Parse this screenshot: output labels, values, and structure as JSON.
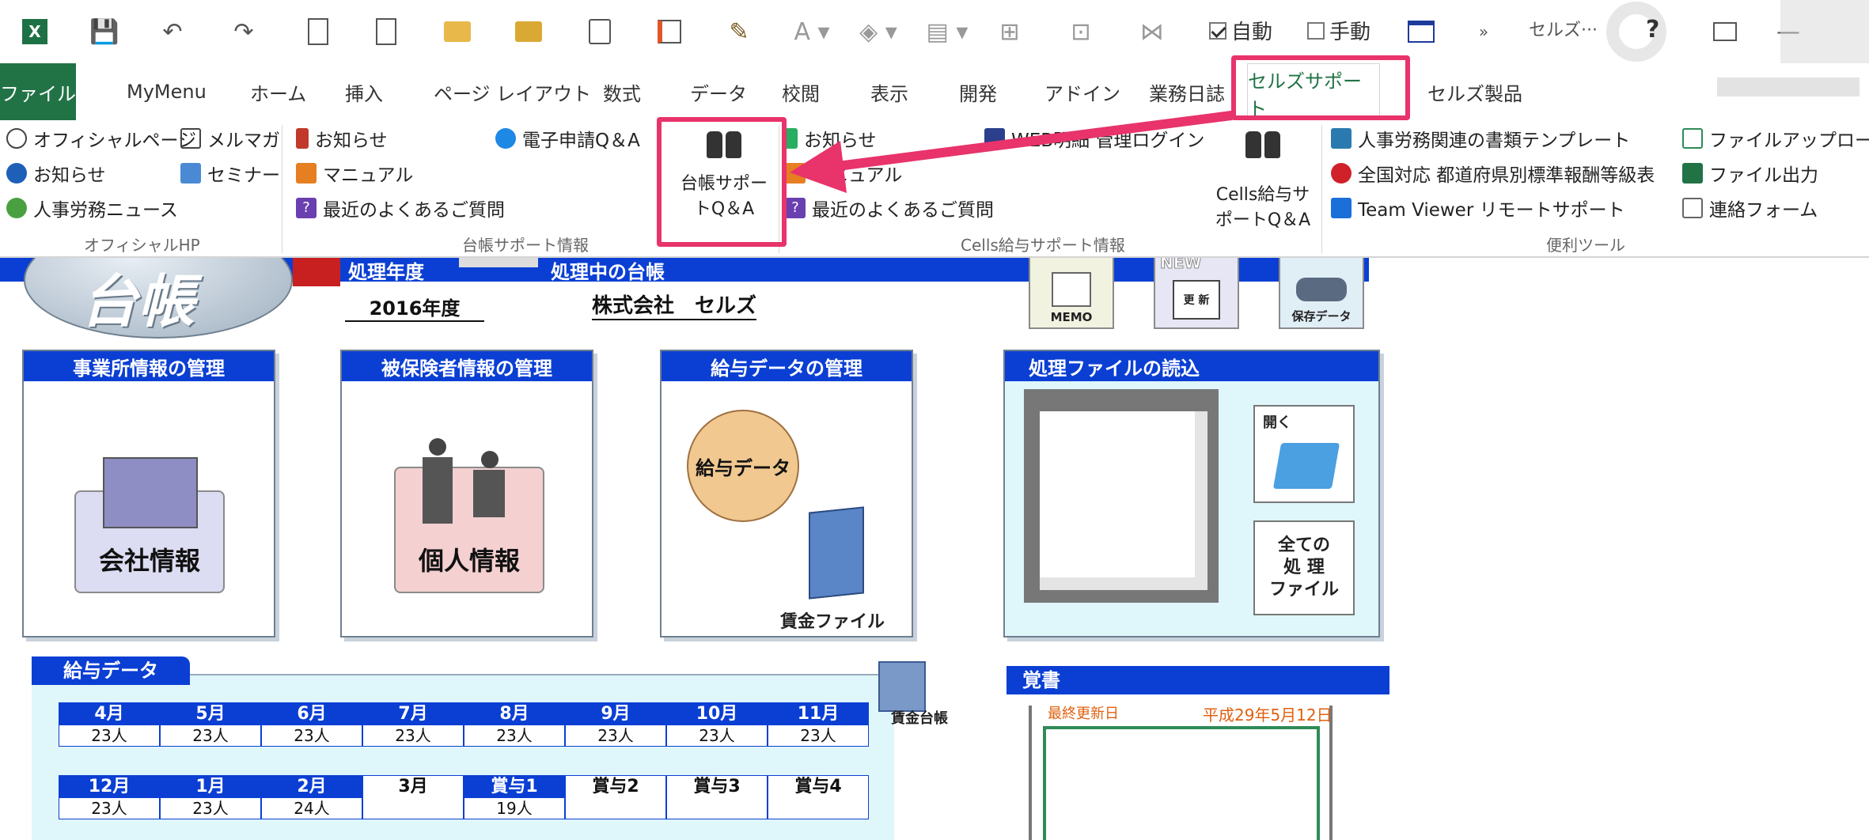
{
  "qat": {
    "auto_label": "自動",
    "manual_label": "手動",
    "account": "セルズ···",
    "help": "?"
  },
  "tabs": [
    "ファイル",
    "MyMenu",
    "ホーム",
    "挿入",
    "ページ レイアウト",
    "数式",
    "データ",
    "校閲",
    "表示",
    "開発",
    "アドイン",
    "業務日誌",
    "セルズサポート",
    "セルズ製品"
  ],
  "ribbon": {
    "official": {
      "items": [
        "オフィシャルページ",
        "メルマガ",
        "お知らせ",
        "セミナー",
        "人事労務ニュース"
      ],
      "group": "オフィシャルHP"
    },
    "daicho": {
      "items": [
        "お知らせ",
        "マニュアル",
        "最近のよくあるご質問",
        "電子申請Q＆A"
      ],
      "big_line1": "台帳サポー",
      "big_line2": "トQ＆A",
      "group": "台帳サポート情報"
    },
    "cells": {
      "items": [
        "お知らせ",
        "マニュアル",
        "最近のよくあるご質問",
        "WEB明細 管理ログイン"
      ],
      "big_line1": "Cells給与サ",
      "big_line2": "ポートQ＆A",
      "group": "Cells給与サポート情報"
    },
    "tools": {
      "items": [
        "人事労務関連の書類テンプレート",
        "全国対応 都道府県別標準報酬等級表",
        "Team Viewer リモートサポート",
        "ファイルアップロード",
        "ファイル出力",
        "連絡フォーム"
      ],
      "group": "便利ツール"
    }
  },
  "sheet": {
    "logo": "台帳",
    "hdr_year_label": "処理年度",
    "hdr_book_label": "処理中の台帳",
    "year": "2016年度",
    "company": "株式会社　セルズ",
    "icons": {
      "memo": "MEMO",
      "new": "NEW",
      "update": "更 新",
      "save": "保存データ"
    },
    "panels": {
      "office": "事業所情報の管理",
      "company_btn": "会社情報",
      "insured": "被保険者情報の管理",
      "person_btn": "個人情報",
      "salary": "給与データの管理",
      "salary_btn": "給与データ",
      "wage_file": "賃金ファイル",
      "files": "処理ファイルの読込",
      "open": "開く",
      "all_line1": "全ての",
      "all_line2": "処 理",
      "all_line3": "ファイル"
    },
    "salary_data": {
      "title": "給与データ",
      "ledger": "賃金台帳",
      "row1": [
        {
          "m": "4月",
          "v": "23人"
        },
        {
          "m": "5月",
          "v": "23人"
        },
        {
          "m": "6月",
          "v": "23人"
        },
        {
          "m": "7月",
          "v": "23人"
        },
        {
          "m": "8月",
          "v": "23人"
        },
        {
          "m": "9月",
          "v": "23人"
        },
        {
          "m": "10月",
          "v": "23人"
        },
        {
          "m": "11月",
          "v": "23人"
        }
      ],
      "row2": [
        {
          "m": "12月",
          "v": "23人"
        },
        {
          "m": "1月",
          "v": "23人"
        },
        {
          "m": "2月",
          "v": "24人"
        },
        {
          "m": "3月",
          "v": ""
        },
        {
          "m": "賞与1",
          "v": "19人"
        },
        {
          "m": "賞与2",
          "v": ""
        },
        {
          "m": "賞与3",
          "v": ""
        },
        {
          "m": "賞与4",
          "v": ""
        }
      ]
    },
    "memo": {
      "title": "覚書",
      "updated_label": "最終更新日",
      "updated_value": "平成29年5月12日"
    }
  },
  "colors": {
    "accent_green": "#217346",
    "sheet_blue": "#0b3fd4",
    "highlight": "#e8336b"
  }
}
